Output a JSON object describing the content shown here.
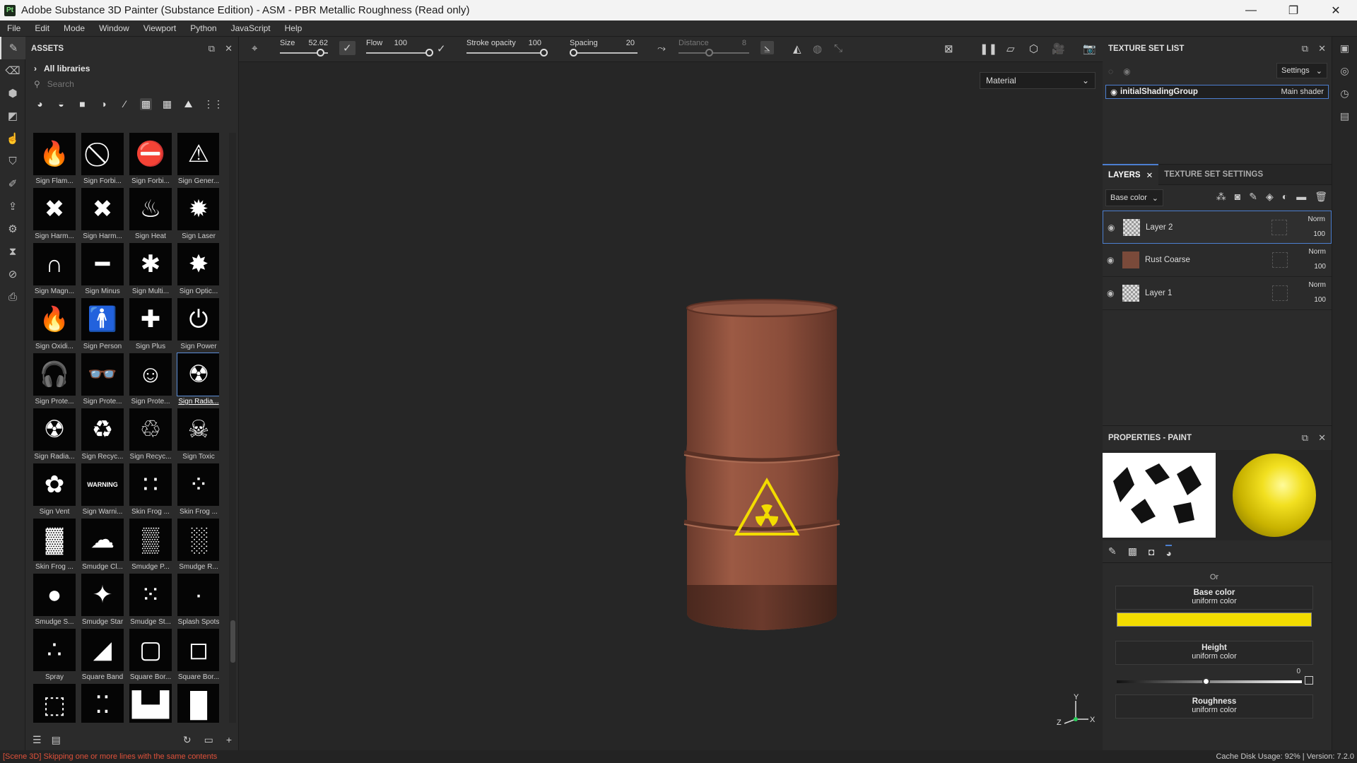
{
  "window": {
    "app_icon": "Pt",
    "title": "Adobe Substance 3D Painter (Substance Edition) - ASM - PBR Metallic Roughness (Read only)",
    "controls": [
      "—",
      "❐",
      "✕"
    ]
  },
  "menu": [
    "File",
    "Edit",
    "Mode",
    "Window",
    "Viewport",
    "Python",
    "JavaScript",
    "Help"
  ],
  "assets": {
    "title": "ASSETS",
    "library": "All libraries",
    "search_placeholder": "Search",
    "tiles": [
      {
        "label": "Sign Flam...",
        "glyph": "🔥"
      },
      {
        "label": "Sign Forbi...",
        "glyph": "⃠"
      },
      {
        "label": "Sign Forbi...",
        "glyph": "⛔"
      },
      {
        "label": "Sign Gener...",
        "glyph": "⚠"
      },
      {
        "label": "Sign Harm...",
        "glyph": "✖"
      },
      {
        "label": "Sign Harm...",
        "glyph": "✖"
      },
      {
        "label": "Sign Heat",
        "glyph": "♨"
      },
      {
        "label": "Sign Laser",
        "glyph": "✹"
      },
      {
        "label": "Sign Magn...",
        "glyph": "∩"
      },
      {
        "label": "Sign Minus",
        "glyph": "━"
      },
      {
        "label": "Sign Multi...",
        "glyph": "✱"
      },
      {
        "label": "Sign Optic...",
        "glyph": "✸"
      },
      {
        "label": "Sign Oxidi...",
        "glyph": "🔥"
      },
      {
        "label": "Sign Person",
        "glyph": "🚹"
      },
      {
        "label": "Sign Plus",
        "glyph": "✚"
      },
      {
        "label": "Sign Power",
        "glyph": "⏻"
      },
      {
        "label": "Sign Prote...",
        "glyph": "🎧"
      },
      {
        "label": "Sign Prote...",
        "glyph": "👓"
      },
      {
        "label": "Sign Prote...",
        "glyph": "☺"
      },
      {
        "label": "Sign Radia...",
        "glyph": "☢"
      },
      {
        "label": "Sign Radia...",
        "glyph": "☢"
      },
      {
        "label": "Sign Recyc...",
        "glyph": "♻"
      },
      {
        "label": "Sign Recyc...",
        "glyph": "♲"
      },
      {
        "label": "Sign Toxic",
        "glyph": "☠"
      },
      {
        "label": "Sign Vent",
        "glyph": "✿"
      },
      {
        "label": "Sign Warni...",
        "glyph": "WARNING"
      },
      {
        "label": "Skin Frog ...",
        "glyph": "∷"
      },
      {
        "label": "Skin Frog ...",
        "glyph": "⁘"
      },
      {
        "label": "Skin Frog ...",
        "glyph": "▓"
      },
      {
        "label": "Smudge Cl...",
        "glyph": "☁"
      },
      {
        "label": "Smudge P...",
        "glyph": "▒"
      },
      {
        "label": "Smudge R...",
        "glyph": "░"
      },
      {
        "label": "Smudge S...",
        "glyph": "●"
      },
      {
        "label": "Smudge Star",
        "glyph": "✦"
      },
      {
        "label": "Smudge St...",
        "glyph": "⁙"
      },
      {
        "label": "Splash Spots",
        "glyph": "·"
      },
      {
        "label": "Spray",
        "glyph": "∴"
      },
      {
        "label": "Square Band",
        "glyph": "◢"
      },
      {
        "label": "Square Bor...",
        "glyph": "▢"
      },
      {
        "label": "Square Bor...",
        "glyph": "◻"
      },
      {
        "label": "",
        "glyph": "⬚"
      },
      {
        "label": "",
        "glyph": "⁚⁚"
      },
      {
        "label": "",
        "glyph": "▙▟"
      },
      {
        "label": "",
        "glyph": "█"
      }
    ],
    "selected_index": 19
  },
  "toolbar": {
    "size_label": "Size",
    "size_value": "52.62",
    "flow_label": "Flow",
    "flow_value": "100",
    "stroke_label": "Stroke opacity",
    "stroke_value": "100",
    "spacing_label": "Spacing",
    "spacing_value": "20",
    "distance_label": "Distance",
    "distance_value": "8"
  },
  "viewport": {
    "display_mode": "Material",
    "axis_labels": {
      "x": "X",
      "y": "Y",
      "z": "Z"
    }
  },
  "texture_set_list": {
    "title": "TEXTURE SET LIST",
    "settings": "Settings",
    "row_name": "initialShadingGroup",
    "row_shader": "Main shader"
  },
  "layers": {
    "tab_layers": "LAYERS",
    "tab_tss": "TEXTURE SET SETTINGS",
    "channel": "Base color",
    "items": [
      {
        "name": "Layer 2",
        "blend": "Norm",
        "opacity": "100"
      },
      {
        "name": "Rust Coarse",
        "blend": "Norm",
        "opacity": "100"
      },
      {
        "name": "Layer 1",
        "blend": "Norm",
        "opacity": "100"
      }
    ]
  },
  "properties": {
    "title": "PROPERTIES - PAINT",
    "or_label": "Or",
    "base_color_title": "Base color",
    "base_color_sub": "uniform color",
    "base_color_hex": "#f2dc00",
    "height_title": "Height",
    "height_sub": "uniform color",
    "height_value": "0",
    "roughness_title": "Roughness",
    "roughness_sub": "uniform color"
  },
  "status": {
    "message": "[Scene 3D] Skipping one or more lines with the same contents",
    "cache_label": "Cache Disk Usage:",
    "cache_value": "92%",
    "version": "Version: 7.2.0"
  }
}
